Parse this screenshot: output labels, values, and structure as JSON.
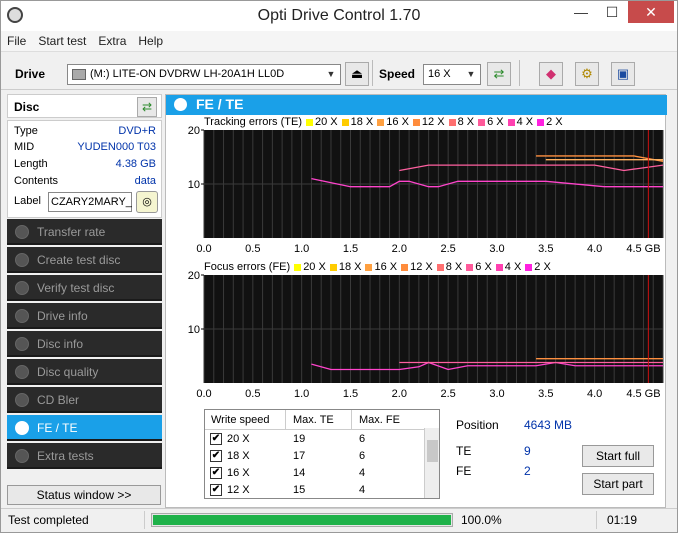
{
  "window": {
    "title": "Opti Drive Control 1.70",
    "minimize": "—",
    "maximize": "☐",
    "close": "✕"
  },
  "menu": [
    "File",
    "Start test",
    "Extra",
    "Help"
  ],
  "toolbar": {
    "drive_label": "Drive",
    "drive_value": "(M:)   LITE-ON DVDRW LH-20A1H LL0D",
    "speed_label": "Speed",
    "speed_value": "16 X"
  },
  "disc": {
    "header": "Disc",
    "rows": [
      {
        "k": "Type",
        "v": "DVD+R"
      },
      {
        "k": "MID",
        "v": "YUDEN000 T03"
      },
      {
        "k": "Length",
        "v": "4.38 GB"
      },
      {
        "k": "Contents",
        "v": "data"
      }
    ],
    "label_key": "Label",
    "label_value": "CZARY2MARY_"
  },
  "nav": [
    "Transfer rate",
    "Create test disc",
    "Verify test disc",
    "Drive info",
    "Disc info",
    "Disc quality",
    "CD Bler",
    "FE / TE",
    "Extra tests"
  ],
  "active_nav": 7,
  "status_window_btn": "Status window >>",
  "panel_title": "FE / TE",
  "chart_data": [
    {
      "type": "line",
      "title": "Tracking errors (TE)",
      "legend": [
        "20 X",
        "18 X",
        "16 X",
        "12 X",
        "8 X",
        "6 X",
        "4 X",
        "2 X"
      ],
      "legend_colors": [
        "#ffff00",
        "#ffcc00",
        "#ffa040",
        "#ff8c3c",
        "#ff7070",
        "#ff5a9a",
        "#ff40b0",
        "#ff20e0"
      ],
      "x_ticks": [
        "0.0",
        "0.5",
        "1.0",
        "1.5",
        "2.0",
        "2.5",
        "3.0",
        "3.5",
        "4.0",
        "4.5 GB"
      ],
      "y_ticks": [
        "20",
        "10"
      ],
      "ylim": [
        0,
        20
      ],
      "xlim": [
        0,
        4.7
      ],
      "series": [
        {
          "color": "#ff44cc",
          "x": [
            1.1,
            1.5,
            1.9,
            2.0,
            2.1,
            2.3,
            2.4,
            2.6,
            2.8,
            3.5,
            4.1,
            4.7
          ],
          "y": [
            11,
            9.5,
            9.5,
            10.5,
            10.5,
            9.5,
            9.5,
            10.5,
            10.5,
            10.5,
            9.5,
            9.5
          ]
        },
        {
          "color": "#ff60a0",
          "x": [
            2.0,
            2.3,
            3.6,
            4.0,
            4.3,
            4.7
          ],
          "y": [
            12.5,
            13.5,
            13.5,
            13.5,
            12.5,
            13.5
          ]
        },
        {
          "color": "#ff9040",
          "x": [
            3.4,
            4.4,
            4.7
          ],
          "y": [
            15.2,
            15.2,
            14.2
          ]
        },
        {
          "color": "#ffb060",
          "x": [
            3.5,
            4.7
          ],
          "y": [
            14.5,
            14.5
          ]
        }
      ]
    },
    {
      "type": "line",
      "title": "Focus errors (FE)",
      "legend": [
        "20 X",
        "18 X",
        "16 X",
        "12 X",
        "8 X",
        "6 X",
        "4 X",
        "2 X"
      ],
      "legend_colors": [
        "#ffff00",
        "#ffcc00",
        "#ffa040",
        "#ff8c3c",
        "#ff7070",
        "#ff5a9a",
        "#ff40b0",
        "#ff20e0"
      ],
      "x_ticks": [
        "0.0",
        "0.5",
        "1.0",
        "1.5",
        "2.0",
        "2.5",
        "3.0",
        "3.5",
        "4.0",
        "4.5 GB"
      ],
      "y_ticks": [
        "20",
        "10"
      ],
      "ylim": [
        0,
        20
      ],
      "xlim": [
        0,
        4.7
      ],
      "series": [
        {
          "color": "#ff44cc",
          "x": [
            1.1,
            1.3,
            2.0,
            2.2,
            2.3,
            2.5,
            2.7,
            3.4,
            3.6,
            3.8,
            4.7
          ],
          "y": [
            3.5,
            2.5,
            2.5,
            3.0,
            3.8,
            2.5,
            3.2,
            3.2,
            3.8,
            3.2,
            3.2
          ]
        },
        {
          "color": "#ff60a0",
          "x": [
            2.0,
            4.7
          ],
          "y": [
            3.8,
            3.8
          ]
        },
        {
          "color": "#ff9040",
          "x": [
            3.4,
            4.7
          ],
          "y": [
            4.5,
            4.5
          ]
        }
      ]
    }
  ],
  "table": {
    "headers": [
      "Write speed",
      "Max. TE",
      "Max. FE"
    ],
    "rows": [
      {
        "speed": "20 X",
        "te": "19",
        "fe": "6",
        "checked": "✔"
      },
      {
        "speed": "18 X",
        "te": "17",
        "fe": "6",
        "checked": "✔"
      },
      {
        "speed": "16 X",
        "te": "14",
        "fe": "4",
        "checked": "✔"
      },
      {
        "speed": "12 X",
        "te": "15",
        "fe": "4",
        "checked": "✔"
      }
    ]
  },
  "stats": {
    "position_label": "Position",
    "position_value": "4643 MB",
    "te_label": "TE",
    "te_value": "9",
    "fe_label": "FE",
    "fe_value": "2"
  },
  "buttons": {
    "start_full": "Start full",
    "start_part": "Start part"
  },
  "status": {
    "text": "Test completed",
    "progress": 100.0,
    "progress_text": "100.0%",
    "time": "01:19"
  }
}
